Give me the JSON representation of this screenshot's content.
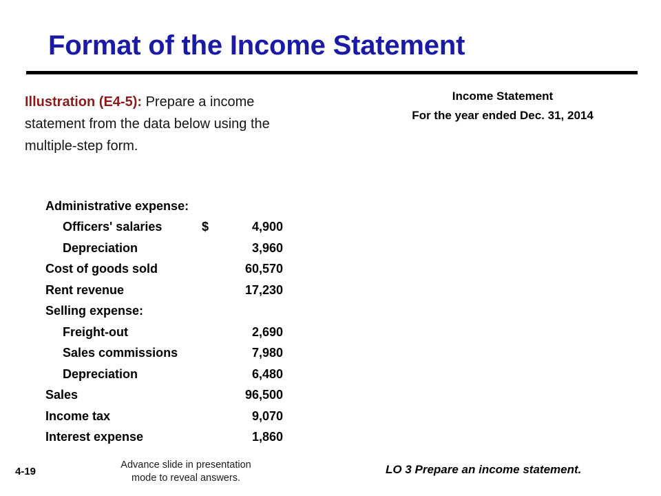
{
  "slide": {
    "title": "Format of the Income Statement",
    "title_color": "#1A1AA6",
    "rule_color": "#000000"
  },
  "illustration": {
    "label": "Illustration (E4-5):",
    "label_color": "#8C1A1A",
    "body": " Prepare a income statement from the data below using the multiple-step form."
  },
  "statement_header": {
    "line1": "Income Statement",
    "line2": "For the year ended Dec. 31, 2014"
  },
  "data_table": {
    "rows": [
      {
        "label": "Administrative expense:",
        "indent": false,
        "currency": "",
        "amount": ""
      },
      {
        "label": "Officers' salaries",
        "indent": true,
        "currency": "$",
        "amount": "4,900"
      },
      {
        "label": "Depreciation",
        "indent": true,
        "currency": "",
        "amount": "3,960"
      },
      {
        "label": "Cost of goods sold",
        "indent": false,
        "currency": "",
        "amount": "60,570"
      },
      {
        "label": "Rent revenue",
        "indent": false,
        "currency": "",
        "amount": "17,230"
      },
      {
        "label": "Selling expense:",
        "indent": false,
        "currency": "",
        "amount": ""
      },
      {
        "label": "Freight-out",
        "indent": true,
        "currency": "",
        "amount": "2,690"
      },
      {
        "label": "Sales commissions",
        "indent": true,
        "currency": "",
        "amount": "7,980"
      },
      {
        "label": "Depreciation",
        "indent": true,
        "currency": "",
        "amount": "6,480"
      },
      {
        "label": "Sales",
        "indent": false,
        "currency": "",
        "amount": "96,500"
      },
      {
        "label": "Income tax",
        "indent": false,
        "currency": "",
        "amount": "9,070"
      },
      {
        "label": "Interest expense",
        "indent": false,
        "currency": "",
        "amount": "1,860"
      }
    ]
  },
  "footer": {
    "page_number": "4-19",
    "note_line1": "Advance slide in presentation",
    "note_line2": "mode to reveal answers.",
    "learning_objective": "LO 3  Prepare an income statement."
  }
}
